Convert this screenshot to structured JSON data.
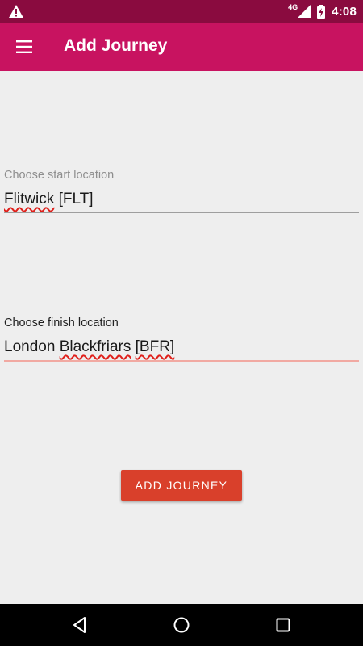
{
  "status_bar": {
    "network_type": "4G",
    "time": "4:08",
    "icons": [
      "warning-icon",
      "cellular-signal-icon",
      "battery-charging-icon"
    ]
  },
  "app_bar": {
    "title": "Add Journey",
    "menu_icon": "menu-icon"
  },
  "form": {
    "start": {
      "label": "Choose start location",
      "value_station": "Flitwick",
      "value_code": "[FLT]"
    },
    "finish": {
      "label": "Choose finish location",
      "value_prefix": "London",
      "value_station": "Blackfriars",
      "value_code": "[BFR]"
    },
    "submit_label": "ADD JOURNEY"
  },
  "nav_bar": {
    "icons": [
      "back-icon",
      "home-icon",
      "recents-icon"
    ]
  },
  "colors": {
    "status_bar": "#8a0b3f",
    "app_bar": "#c81360",
    "button": "#d9402b",
    "background": "#eeeeee",
    "spellcheck_underline": "#e0201b",
    "active_field_underline": "#f1a9a2"
  }
}
